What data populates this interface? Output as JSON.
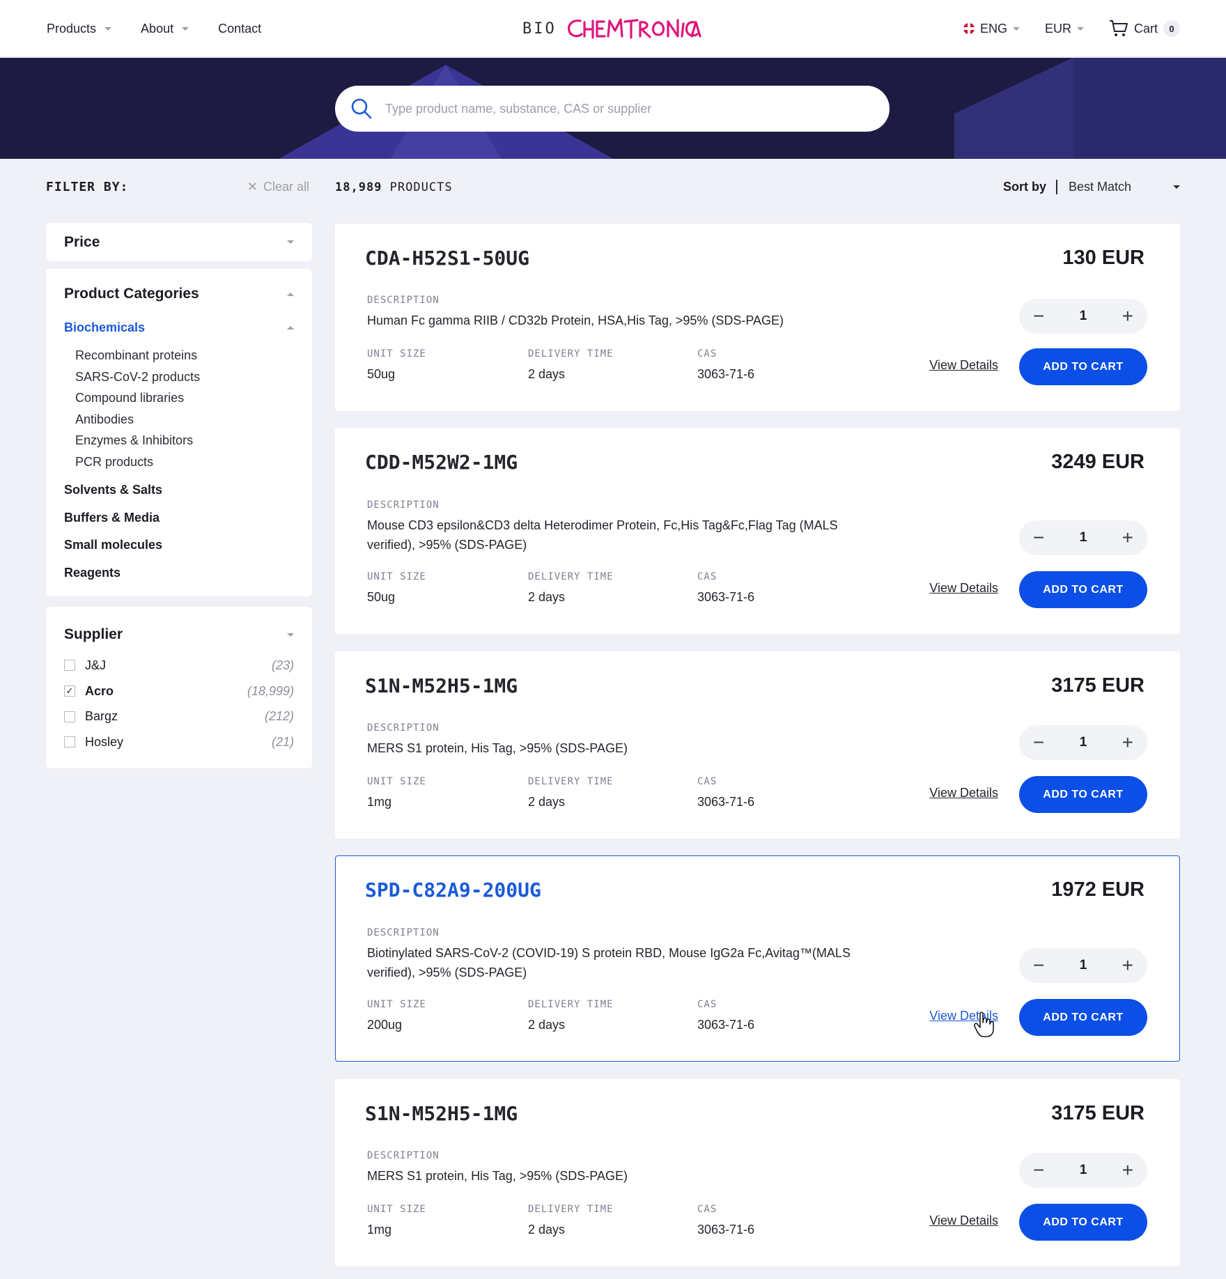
{
  "header": {
    "nav": [
      {
        "label": "Products",
        "has_caret": true
      },
      {
        "label": "About",
        "has_caret": true
      },
      {
        "label": "Contact",
        "has_caret": false
      }
    ],
    "logo_prefix": "BIO",
    "logo_script": "CHEMTRONICA",
    "language": "ENG",
    "currency": "EUR",
    "cart_label": "Cart",
    "cart_count": "0"
  },
  "search": {
    "placeholder": "Type product name, substance, CAS or supplier",
    "value": ""
  },
  "filters": {
    "title": "FILTER BY:",
    "clear_label": "Clear all",
    "price_title": "Price",
    "categories_title": "Product Categories",
    "active_category": "Biochemicals",
    "subcategories": [
      "Recombinant proteins",
      "SARS-CoV-2 products",
      "Compound libraries",
      "Antibodies",
      "Enzymes & Inhibitors",
      "PCR products"
    ],
    "main_categories": [
      "Solvents & Salts",
      "Buffers & Media",
      "Small molecules",
      "Reagents"
    ],
    "supplier_title": "Supplier",
    "suppliers": [
      {
        "name": "J&J",
        "count": "(23)",
        "checked": false
      },
      {
        "name": "Acro",
        "count": "(18,999)",
        "checked": true
      },
      {
        "name": "Bargz",
        "count": "(212)",
        "checked": false
      },
      {
        "name": "Hosley",
        "count": "(21)",
        "checked": false
      }
    ]
  },
  "results": {
    "count": "18,989",
    "count_label": "PRODUCTS",
    "sort_label": "Sort by",
    "sort_value": "Best Match",
    "labels": {
      "description": "DESCRIPTION",
      "unit_size": "UNIT SIZE",
      "delivery_time": "DELIVERY TIME",
      "cas": "CAS",
      "view_details": "View Details",
      "add_to_cart": "ADD TO CART"
    },
    "products": [
      {
        "sku": "CDA-H52S1-50UG",
        "price": "130 EUR",
        "description": "Human Fc gamma RIIB / CD32b Protein, HSA,His Tag, >95% (SDS-PAGE)",
        "unit_size": "50ug",
        "delivery": "2 days",
        "cas": "3063-71-6",
        "qty": "1"
      },
      {
        "sku": "CDD-M52W2-1MG",
        "price": "3249 EUR",
        "description": "Mouse CD3 epsilon&CD3 delta Heterodimer Protein, Fc,His Tag&Fc,Flag Tag (MALS verified), >95% (SDS-PAGE)",
        "unit_size": "50ug",
        "delivery": "2 days",
        "cas": "3063-71-6",
        "qty": "1"
      },
      {
        "sku": "S1N-M52H5-1MG",
        "price": "3175 EUR",
        "description": "MERS S1 protein, His Tag, >95% (SDS-PAGE)",
        "unit_size": "1mg",
        "delivery": "2 days",
        "cas": "3063-71-6",
        "qty": "1"
      },
      {
        "sku": "SPD-C82A9-200UG",
        "price": "1972 EUR",
        "description": "Biotinylated SARS-CoV-2 (COVID-19) S protein RBD, Mouse IgG2a Fc,Avitag™(MALS verified), >95% (SDS-PAGE)",
        "unit_size": "200ug",
        "delivery": "2 days",
        "cas": "3063-71-6",
        "qty": "1"
      },
      {
        "sku": "S1N-M52H5-1MG",
        "price": "3175 EUR",
        "description": "MERS S1 protein, His Tag, >95% (SDS-PAGE)",
        "unit_size": "1mg",
        "delivery": "2 days",
        "cas": "3063-71-6",
        "qty": "1"
      }
    ]
  },
  "colors": {
    "accent": "#0b4fe6",
    "link_active": "#1a5ad7",
    "hero_bg": "#1e1b42",
    "logo": "#e0157a",
    "page_bg": "#f0f1f6"
  }
}
